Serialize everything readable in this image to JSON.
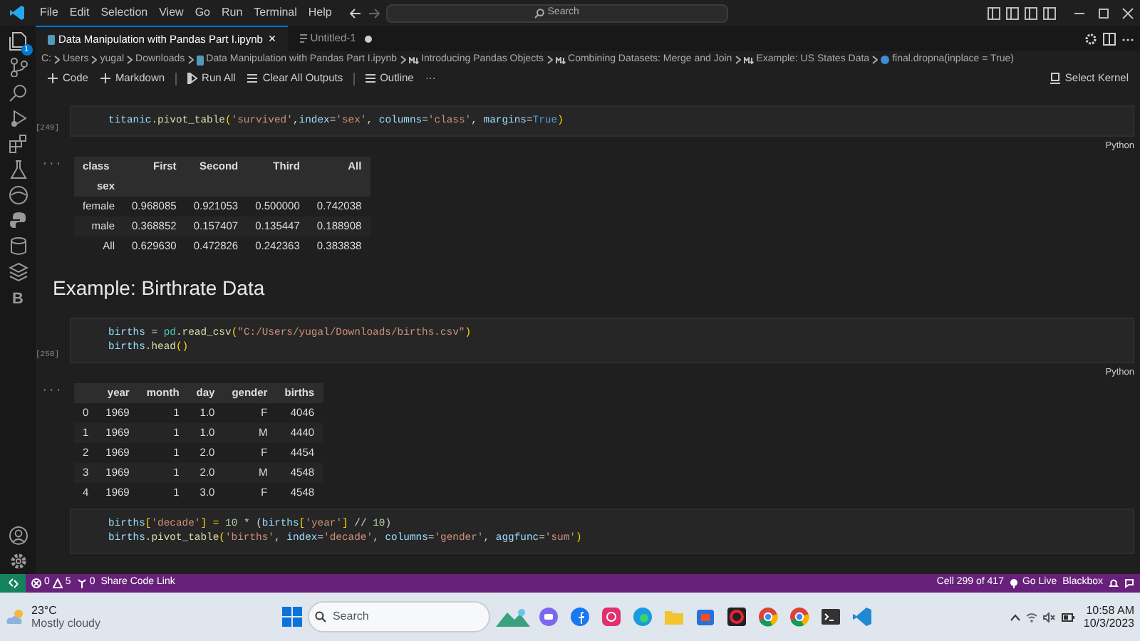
{
  "menu": [
    "File",
    "Edit",
    "Selection",
    "View",
    "Go",
    "Run",
    "Terminal",
    "Help"
  ],
  "search": {
    "placeholder": "Search"
  },
  "explorer_badge": "1",
  "activity_letter": "B",
  "tabs": [
    {
      "label": "Data Manipulation with Pandas Part I.ipynb",
      "selected": true,
      "modified": false,
      "close": "×"
    },
    {
      "label": "Untitled-1",
      "selected": false,
      "modified": true
    }
  ],
  "breadcrumb": [
    {
      "kind": "folder",
      "text": "C:"
    },
    {
      "kind": "folder",
      "text": "Users"
    },
    {
      "kind": "folder",
      "text": "yugal"
    },
    {
      "kind": "folder",
      "text": "Downloads"
    },
    {
      "kind": "file",
      "text": "Data Manipulation with Pandas Part I.ipynb"
    },
    {
      "kind": "heading",
      "text": "Introducing Pandas Objects"
    },
    {
      "kind": "heading",
      "text": "Combining Datasets: Merge and Join"
    },
    {
      "kind": "heading",
      "text": "Example: US States Data"
    },
    {
      "kind": "code",
      "text": "final.dropna(inplace = True)"
    }
  ],
  "toolbar": [
    {
      "kind": "add",
      "text": "Code"
    },
    {
      "kind": "add",
      "text": "Markdown"
    },
    {
      "kind": "run",
      "text": "Run All"
    },
    {
      "kind": "clear",
      "text": "Clear All Outputs"
    },
    {
      "kind": "outline",
      "text": "Outline"
    },
    {
      "kind": "more",
      "text": "···"
    }
  ],
  "kernel": "Select Kernel",
  "cells": [
    {
      "kind": "code",
      "count": "[249]",
      "language": "Python",
      "lines": [
        [
          {
            "text": "titanic",
            "kind": "var"
          },
          {
            "text": ".pivot_table",
            "kind": "func"
          },
          {
            "text": "(",
            "kind": "paren"
          },
          {
            "text": "'survived'",
            "kind": "str"
          },
          {
            "text": ",",
            "kind": "plain"
          },
          {
            "text": "index",
            "kind": "var"
          },
          {
            "text": "=",
            "kind": "plain"
          },
          {
            "text": "'sex'",
            "kind": "str"
          },
          {
            "text": ", ",
            "kind": "plain"
          },
          {
            "text": "columns",
            "kind": "var"
          },
          {
            "text": "=",
            "kind": "plain"
          },
          {
            "text": "'class'",
            "kind": "str"
          },
          {
            "text": ", ",
            "kind": "plain"
          },
          {
            "text": "margins",
            "kind": "var"
          },
          {
            "text": "=",
            "kind": "plain"
          },
          {
            "text": "True",
            "kind": "kw"
          },
          {
            "text": ")",
            "kind": "paren"
          }
        ]
      ]
    },
    {
      "kind": "table",
      "marker": "···",
      "columns": [
        "class",
        "First",
        "Second",
        "Third",
        "All"
      ],
      "index_name": "sex",
      "rows": [
        [
          "female",
          "0.968085",
          "0.921053",
          "0.500000",
          "0.742038"
        ],
        [
          "male",
          "0.368852",
          "0.157407",
          "0.135447",
          "0.188908"
        ],
        [
          "All",
          "0.629630",
          "0.472826",
          "0.242363",
          "0.383838"
        ]
      ]
    },
    {
      "kind": "heading",
      "text": "Example: Birthrate Data"
    },
    {
      "kind": "code",
      "count": "[250]",
      "language": "Python",
      "lines": [
        [
          {
            "text": "births",
            "kind": "var"
          },
          {
            "text": " = ",
            "kind": "plain"
          },
          {
            "text": "pd",
            "kind": "type"
          },
          {
            "text": ".read_csv",
            "kind": "func"
          },
          {
            "text": "(",
            "kind": "paren"
          },
          {
            "text": "\"C:/Users/yugal/Downloads/births.csv\"",
            "kind": "str"
          },
          {
            "text": ")",
            "kind": "paren"
          }
        ],
        [
          {
            "text": "births",
            "kind": "var"
          },
          {
            "text": ".head",
            "kind": "func"
          },
          {
            "text": "()",
            "kind": "paren"
          }
        ]
      ]
    },
    {
      "kind": "table",
      "marker": "···",
      "columns": [
        "",
        "year",
        "month",
        "day",
        "gender",
        "births"
      ],
      "rows": [
        [
          "0",
          "1969",
          "1",
          "1.0",
          "F",
          "4046"
        ],
        [
          "1",
          "1969",
          "1",
          "1.0",
          "M",
          "4440"
        ],
        [
          "2",
          "1969",
          "1",
          "2.0",
          "F",
          "4454"
        ],
        [
          "3",
          "1969",
          "1",
          "2.0",
          "M",
          "4548"
        ],
        [
          "4",
          "1969",
          "1",
          "3.0",
          "F",
          "4548"
        ]
      ]
    },
    {
      "kind": "code",
      "lines": [
        [
          {
            "text": "births",
            "kind": "var"
          },
          {
            "text": "[",
            "kind": "paren"
          },
          {
            "text": "'decade'",
            "kind": "str"
          },
          {
            "text": "] = ",
            "kind": "paren"
          },
          {
            "text": "10",
            "kind": "num"
          },
          {
            "text": " * (",
            "kind": "plain"
          },
          {
            "text": "births",
            "kind": "var"
          },
          {
            "text": "[",
            "kind": "paren"
          },
          {
            "text": "'year'",
            "kind": "str"
          },
          {
            "text": "]",
            "kind": "paren"
          },
          {
            "text": " // ",
            "kind": "plain"
          },
          {
            "text": "10",
            "kind": "num"
          },
          {
            "text": ")",
            "kind": "plain"
          }
        ],
        [
          {
            "text": "births",
            "kind": "var"
          },
          {
            "text": ".pivot_table",
            "kind": "func"
          },
          {
            "text": "(",
            "kind": "paren"
          },
          {
            "text": "'births'",
            "kind": "str"
          },
          {
            "text": ", ",
            "kind": "plain"
          },
          {
            "text": "index",
            "kind": "var"
          },
          {
            "text": "=",
            "kind": "plain"
          },
          {
            "text": "'decade'",
            "kind": "str"
          },
          {
            "text": ", ",
            "kind": "plain"
          },
          {
            "text": "columns",
            "kind": "var"
          },
          {
            "text": "=",
            "kind": "plain"
          },
          {
            "text": "'gender'",
            "kind": "str"
          },
          {
            "text": ", ",
            "kind": "plain"
          },
          {
            "text": "aggfunc",
            "kind": "var"
          },
          {
            "text": "=",
            "kind": "plain"
          },
          {
            "text": "'sum'",
            "kind": "str"
          },
          {
            "text": ")",
            "kind": "paren"
          }
        ]
      ]
    }
  ],
  "status_bar": {
    "errors": "0",
    "warnings": "5",
    "ports": "0",
    "share": "Share Code Link",
    "cell": "Cell 299 of 417",
    "go_live": "Go Live",
    "blackbox": "Blackbox"
  },
  "taskbar": {
    "temperature": "23°C",
    "weather": "Mostly cloudy",
    "search": {
      "placeholder": "Search"
    },
    "time": "10:58 AM",
    "date": "10/3/2023"
  }
}
